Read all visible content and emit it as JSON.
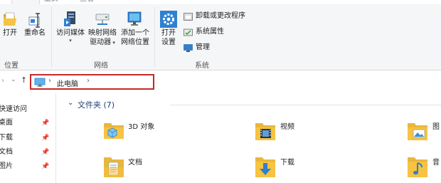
{
  "ribbon": {
    "tabs": [
      "",
      "主页",
      "查看"
    ],
    "location_group": {
      "label": "位置",
      "open": "打开",
      "rename": "重命名"
    },
    "network_group": {
      "label": "网络",
      "media": [
        "访问媒体"
      ],
      "map_drive": [
        "映射网络",
        "驱动器"
      ],
      "add_location": [
        "添加一个",
        "网络位置"
      ]
    },
    "system_group": {
      "label": "系统",
      "open_settings": [
        "打开",
        "设置"
      ],
      "uninstall": "卸载或更改程序",
      "system_props": "系统属性",
      "manage": "管理"
    }
  },
  "address_bar": {
    "location": "此电脑",
    "separator": "›"
  },
  "nav_pane": {
    "items": [
      {
        "label": "快速访问",
        "pinned": false
      },
      {
        "label": "桌面",
        "pinned": true
      },
      {
        "label": "下载",
        "pinned": true
      },
      {
        "label": "文档",
        "pinned": true
      },
      {
        "label": "图片",
        "pinned": true
      }
    ]
  },
  "content": {
    "section_title": "文件夹 (7)",
    "folders": [
      {
        "label": "3D 对象",
        "icon": "3d-objects-folder-icon"
      },
      {
        "label": "视频",
        "icon": "video-folder-icon"
      },
      {
        "label": "图",
        "icon": "pictures-folder-icon"
      },
      {
        "label": "文档",
        "icon": "documents-folder-icon"
      },
      {
        "label": "下载",
        "icon": "downloads-folder-icon"
      },
      {
        "label": "音",
        "icon": "music-folder-icon"
      }
    ]
  },
  "colors": {
    "highlight_border": "#c62828",
    "folder_yellow": "#f6c342",
    "section_blue": "#1e3f74"
  }
}
